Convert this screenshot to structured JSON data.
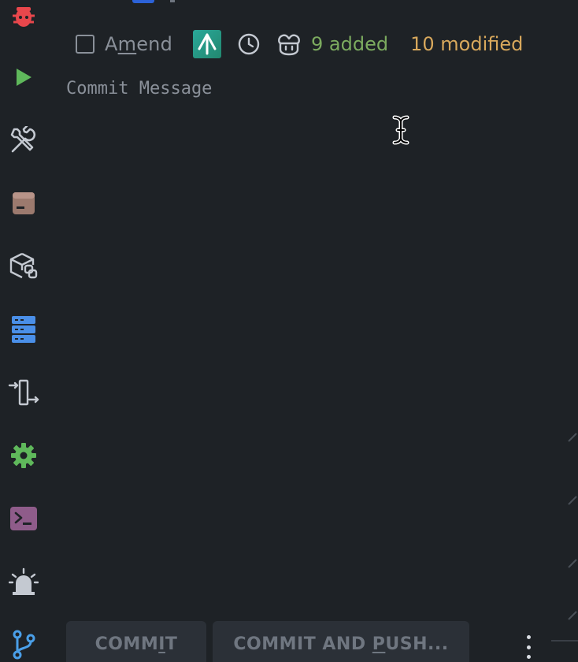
{
  "toolbar": {
    "items": [
      {
        "name": "debug",
        "icon": "bug-icon"
      },
      {
        "name": "run",
        "icon": "play-icon"
      },
      {
        "name": "build-tools",
        "icon": "wrench-screwdriver-icon"
      },
      {
        "name": "archive",
        "icon": "archive-box-icon"
      },
      {
        "name": "python-packages",
        "icon": "python-package-icon"
      },
      {
        "name": "services",
        "icon": "database-server-icon"
      },
      {
        "name": "endpoints",
        "icon": "import-export-icon"
      },
      {
        "name": "settings",
        "icon": "gear-icon"
      },
      {
        "name": "terminal",
        "icon": "terminal-icon"
      },
      {
        "name": "notifications",
        "icon": "alarm-beacon-icon"
      },
      {
        "name": "git",
        "icon": "git-branch-icon"
      }
    ]
  },
  "header": {
    "amend_prefix": "A",
    "amend_mnemonic": "m",
    "amend_suffix": "end",
    "amend_checked": false,
    "added_label": "9 added",
    "modified_label": "10 modified"
  },
  "commit": {
    "placeholder": "Commit Message",
    "value": ""
  },
  "actions": {
    "commit_prefix": "COMM",
    "commit_mnemonic": "I",
    "commit_suffix": "T",
    "push_prefix": "COMMIT AND ",
    "push_mnemonic": "P",
    "push_suffix": "USH..."
  },
  "colors": {
    "background": "#1e2226",
    "added": "#7cab5f",
    "modified": "#d8a85c",
    "muted_text": "#8a9099",
    "button_bg": "#2b3037"
  }
}
